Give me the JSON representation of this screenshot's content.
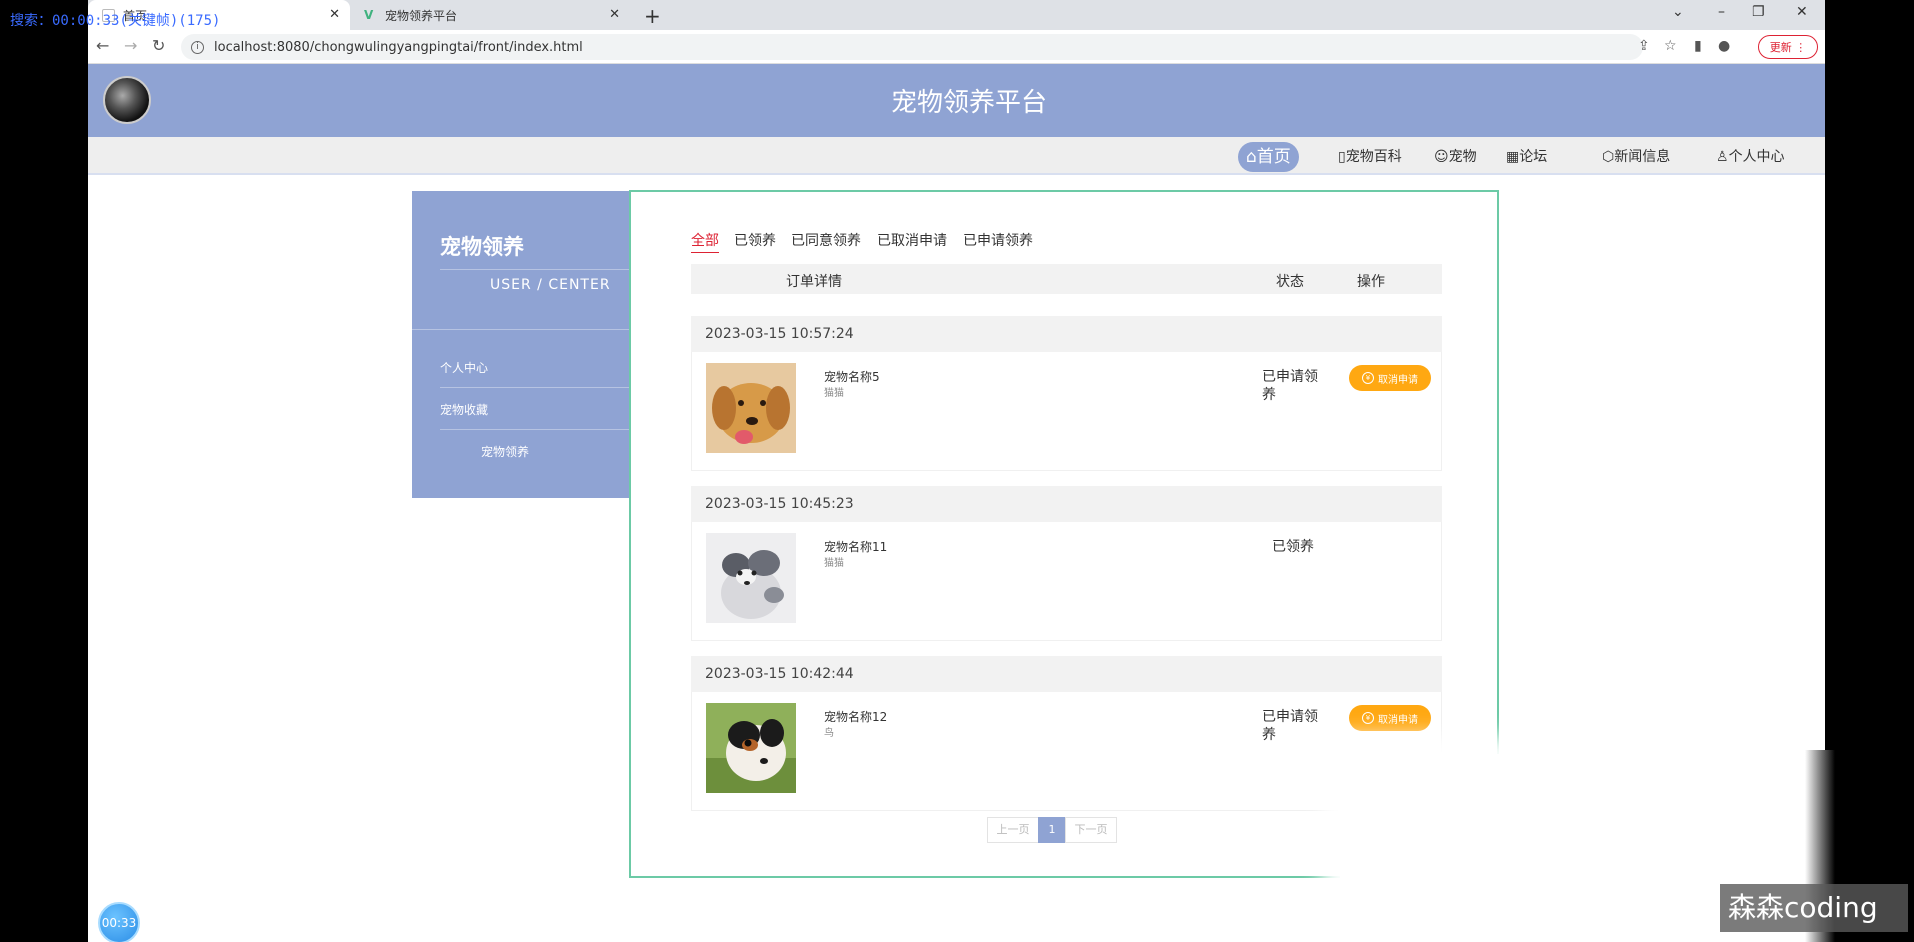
{
  "overlay": {
    "text": "搜索：00:00:33(关键帧)(175)"
  },
  "browser": {
    "tabs": [
      {
        "label": "首页",
        "active": true
      },
      {
        "label": "宠物领养平台",
        "active": false
      }
    ],
    "url": "localhost:8080/chongwulingyangpingtai/front/index.html",
    "update_label": "更新"
  },
  "site": {
    "title": "宠物领养平台",
    "nav": [
      {
        "label": "首页",
        "icon": "home-icon",
        "active": true
      },
      {
        "label": "宠物百科",
        "icon": "book-icon"
      },
      {
        "label": "宠物",
        "icon": "paw-icon"
      },
      {
        "label": "论坛",
        "icon": "forum-icon"
      },
      {
        "label": "新闻信息",
        "icon": "news-icon"
      },
      {
        "label": "个人中心",
        "icon": "user-icon"
      }
    ]
  },
  "sidebar": {
    "title": "宠物领养",
    "subtitle": "USER / CENTER",
    "items": [
      {
        "label": "个人中心"
      },
      {
        "label": "宠物收藏"
      },
      {
        "label": "宠物领养",
        "active": true
      }
    ]
  },
  "filters": [
    "全部",
    "已领养",
    "已同意领养",
    "已取消申请",
    "已申请领养"
  ],
  "table_headers": {
    "details": "订单详情",
    "status": "状态",
    "action": "操作"
  },
  "orders": [
    {
      "datetime": "2023-03-15 10:57:24",
      "name": "宠物名称5",
      "type": "猫猫",
      "status": "已申请领养",
      "action": "取消申请"
    },
    {
      "datetime": "2023-03-15 10:45:23",
      "name": "宠物名称11",
      "type": "猫猫",
      "status": "已领养",
      "action": ""
    },
    {
      "datetime": "2023-03-15 10:42:44",
      "name": "宠物名称12",
      "type": "鸟",
      "status": "已申请领养",
      "action": "取消申请"
    }
  ],
  "pagination": {
    "prev": "上一页",
    "current": "1",
    "next": "下一页"
  },
  "timer": "00:33",
  "watermark": "森森coding",
  "colors": {
    "header": "#8fa3d3",
    "accent_red": "#dd2233",
    "button_orange": "#ffa812",
    "panel_border": "#6ccaa6"
  }
}
